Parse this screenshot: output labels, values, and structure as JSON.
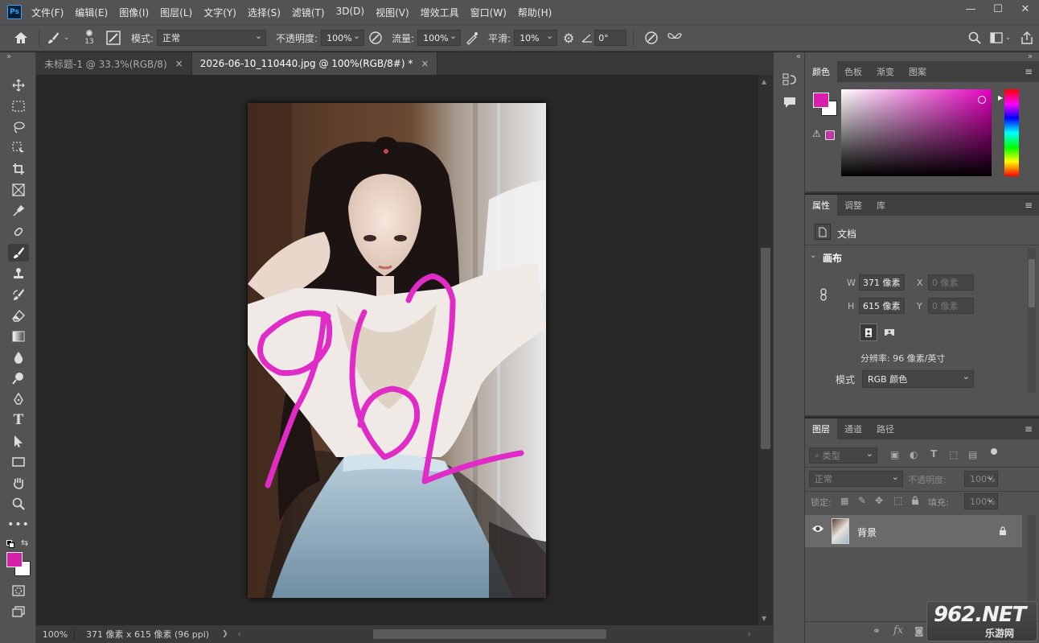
{
  "app": {
    "logo": "Ps"
  },
  "menu": [
    "文件(F)",
    "编辑(E)",
    "图像(I)",
    "图层(L)",
    "文字(Y)",
    "选择(S)",
    "滤镜(T)",
    "3D(D)",
    "视图(V)",
    "增效工具",
    "窗口(W)",
    "帮助(H)"
  ],
  "window_controls": {
    "minimize": "—",
    "maximize": "☐",
    "close": "✕"
  },
  "options": {
    "brush_size": "13",
    "mode_label": "模式:",
    "mode_value": "正常",
    "opacity_label": "不透明度:",
    "opacity_value": "100%",
    "flow_label": "流量:",
    "flow_value": "100%",
    "smooth_label": "平滑:",
    "smooth_value": "10%",
    "angle_value": "0°"
  },
  "tabs": [
    {
      "label": "未标题-1 @ 33.3%(RGB/8)",
      "close": "×"
    },
    {
      "label": "2026-06-10_110440.jpg @ 100%(RGB/8#) *",
      "close": "×"
    }
  ],
  "canvas": {
    "drawn_text": "962",
    "stroke_color": "#e02bc6"
  },
  "status": {
    "zoom": "100%",
    "doc_info": "371 像素 x 615 像素 (96 ppi)",
    "arrow": "❯"
  },
  "colors": {
    "foreground": "#d91ea9",
    "background": "#ffffff",
    "accent": "#31a8ff"
  },
  "color_panel": {
    "tabs": [
      "颜色",
      "色板",
      "渐变",
      "图案"
    ],
    "warning": "⚠"
  },
  "properties": {
    "tabs": [
      "属性",
      "调整",
      "库"
    ],
    "doc_label": "文档",
    "section": "画布",
    "w_label": "W",
    "w_value": "371 像素",
    "h_label": "H",
    "h_value": "615 像素",
    "x_label": "X",
    "x_value": "0 像素",
    "y_label": "Y",
    "y_value": "0 像素",
    "resolution": "分辨率: 96 像素/英寸",
    "mode_label": "模式",
    "mode_value": "RGB 颜色"
  },
  "layers": {
    "tabs": [
      "图层",
      "通道",
      "路径"
    ],
    "filter_placeholder": "类型",
    "blend": "正常",
    "opacity_label": "不透明度:",
    "opacity_value": "100%",
    "lock_label": "锁定:",
    "fill_label": "填充:",
    "fill_value": "100%",
    "layer_name": "背景"
  },
  "watermark": {
    "main": "962.NET",
    "sub": "乐游网"
  }
}
